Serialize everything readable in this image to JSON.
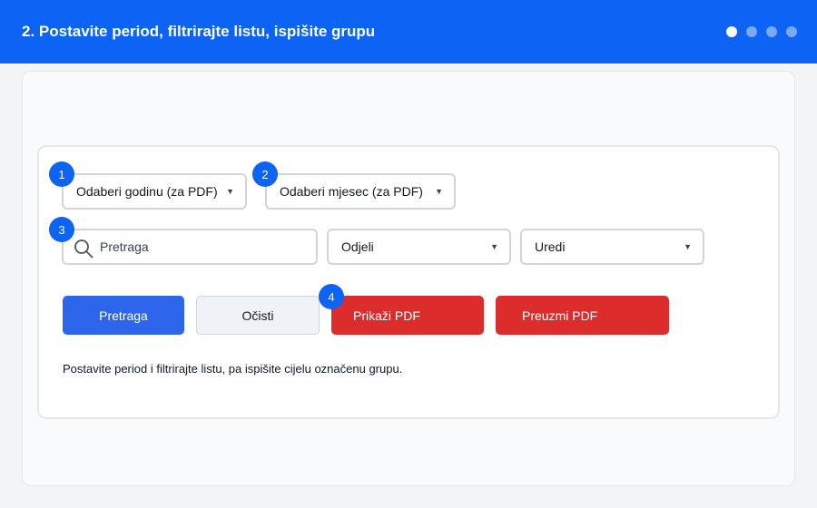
{
  "header": {
    "title": "2. Postavite period, filtrirajte listu, ispišite grupu",
    "step_dots": [
      true,
      false,
      false,
      false
    ]
  },
  "filters": {
    "year": {
      "selected": "Odaberi godinu (za PDF)",
      "badge": "1"
    },
    "month": {
      "selected": "Odaberi mjesec (za PDF)",
      "badge": "2"
    },
    "search": {
      "placeholder": "Pretraga",
      "value": "",
      "badge": "3"
    },
    "departments": {
      "selected": "Odjeli"
    },
    "offices": {
      "selected": "Uredi"
    }
  },
  "actions": {
    "search_label": "Pretraga",
    "clear_label": "Očisti",
    "show_pdf_label": "Prikaži PDF",
    "download_pdf_label": "Preuzmi PDF",
    "pdf_badge": "4"
  },
  "hint": "Postavite period i filtrirajte listu, pa ispišite cijelu označenu grupu.",
  "colors": {
    "header": "#0d63f3",
    "primary": "#2d66ea",
    "danger": "#dc2c2c",
    "badge": "#0d63f3"
  }
}
